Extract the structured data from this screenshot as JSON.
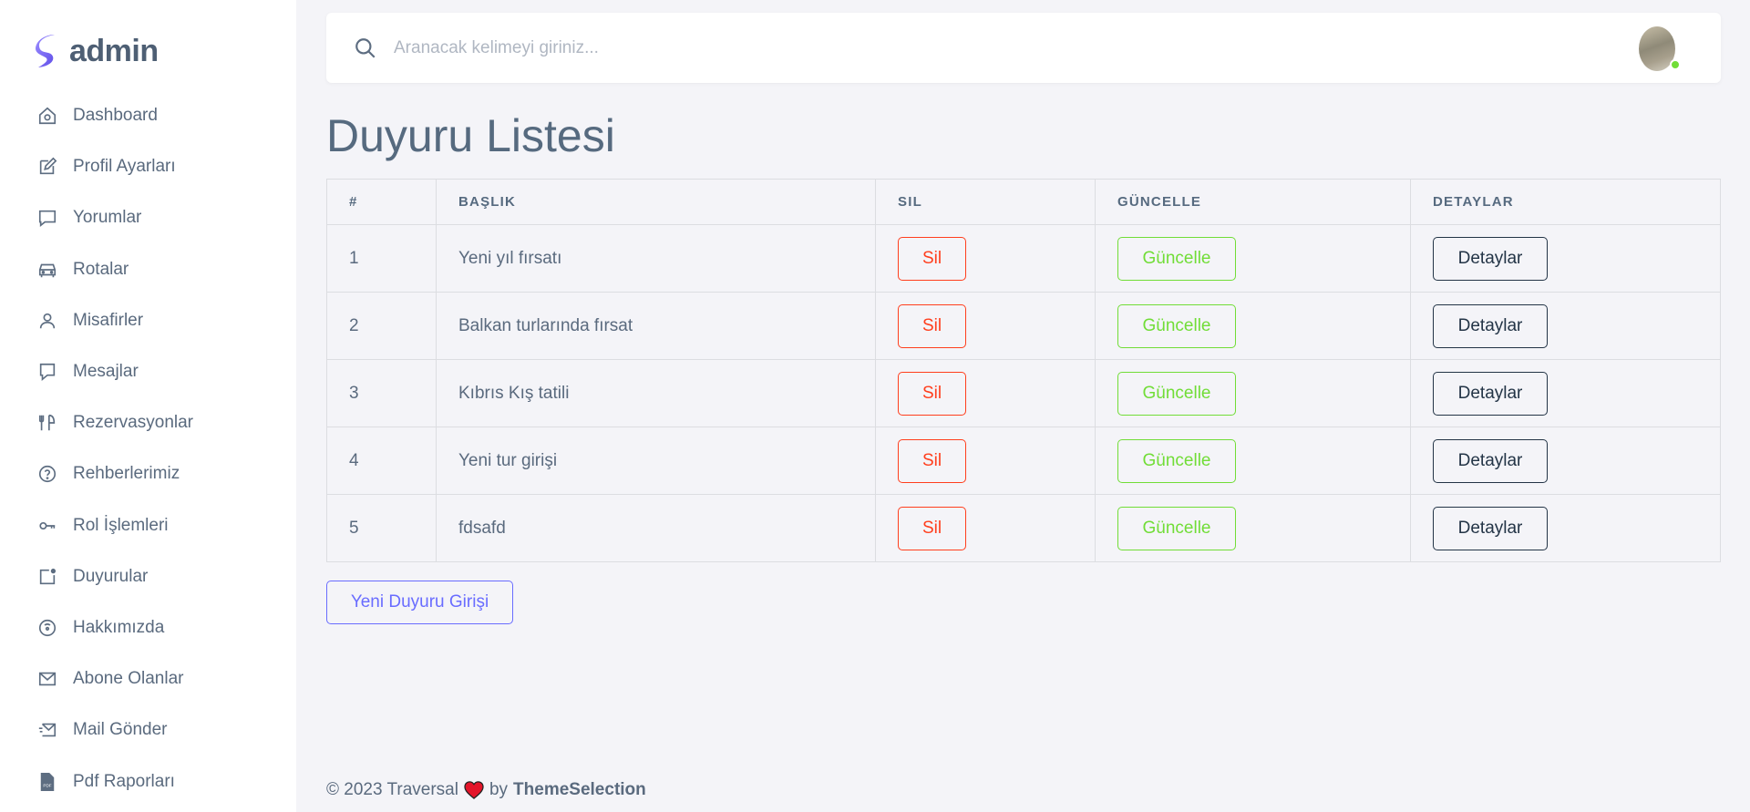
{
  "brand": {
    "name": "admin"
  },
  "sidebar": {
    "items": [
      {
        "label": "Dashboard",
        "icon": "home-icon"
      },
      {
        "label": "Profil Ayarları",
        "icon": "edit-icon"
      },
      {
        "label": "Yorumlar",
        "icon": "comment-icon"
      },
      {
        "label": "Rotalar",
        "icon": "car-icon"
      },
      {
        "label": "Misafirler",
        "icon": "user-icon"
      },
      {
        "label": "Mesajlar",
        "icon": "message-icon"
      },
      {
        "label": "Rezervasyonlar",
        "icon": "restaurant-icon"
      },
      {
        "label": "Rehberlerimiz",
        "icon": "help-circle-icon"
      },
      {
        "label": "Rol İşlemleri",
        "icon": "key-icon"
      },
      {
        "label": "Duyurular",
        "icon": "notification-icon"
      },
      {
        "label": "Hakkımızda",
        "icon": "info-circle-icon"
      },
      {
        "label": "Abone Olanlar",
        "icon": "mail-icon"
      },
      {
        "label": "Mail Gönder",
        "icon": "mail-send-icon"
      },
      {
        "label": "Pdf Raporları",
        "icon": "pdf-file-icon"
      }
    ]
  },
  "search": {
    "placeholder": "Aranacak kelimeyi giriniz..."
  },
  "page": {
    "title": "Duyuru Listesi"
  },
  "table": {
    "headers": [
      "#",
      "BAŞLIK",
      "SIL",
      "GÜNCELLE",
      "DETAYLAR"
    ],
    "rows": [
      {
        "num": "1",
        "title": "Yeni yıl fırsatı",
        "sil": "Sil",
        "guncelle": "Güncelle",
        "detay": "Detaylar"
      },
      {
        "num": "2",
        "title": "Balkan turlarında fırsat",
        "sil": "Sil",
        "guncelle": "Güncelle",
        "detay": "Detaylar"
      },
      {
        "num": "3",
        "title": "Kıbrıs Kış tatili",
        "sil": "Sil",
        "guncelle": "Güncelle",
        "detay": "Detaylar"
      },
      {
        "num": "4",
        "title": "Yeni tur girişi",
        "sil": "Sil",
        "guncelle": "Güncelle",
        "detay": "Detaylar"
      },
      {
        "num": "5",
        "title": "fdsafd",
        "sil": "Sil",
        "guncelle": "Güncelle",
        "detay": "Detaylar"
      }
    ]
  },
  "actions": {
    "new_label": "Yeni Duyuru Girişi"
  },
  "footer": {
    "copyright": "© 2023 Traversal",
    "by": "by",
    "brand": "ThemeSelection"
  },
  "colors": {
    "primary": "#696cff",
    "danger": "#ff3e1d",
    "success": "#71dd37",
    "dark": "#233446",
    "brand_gradient": "#7f63f4"
  }
}
